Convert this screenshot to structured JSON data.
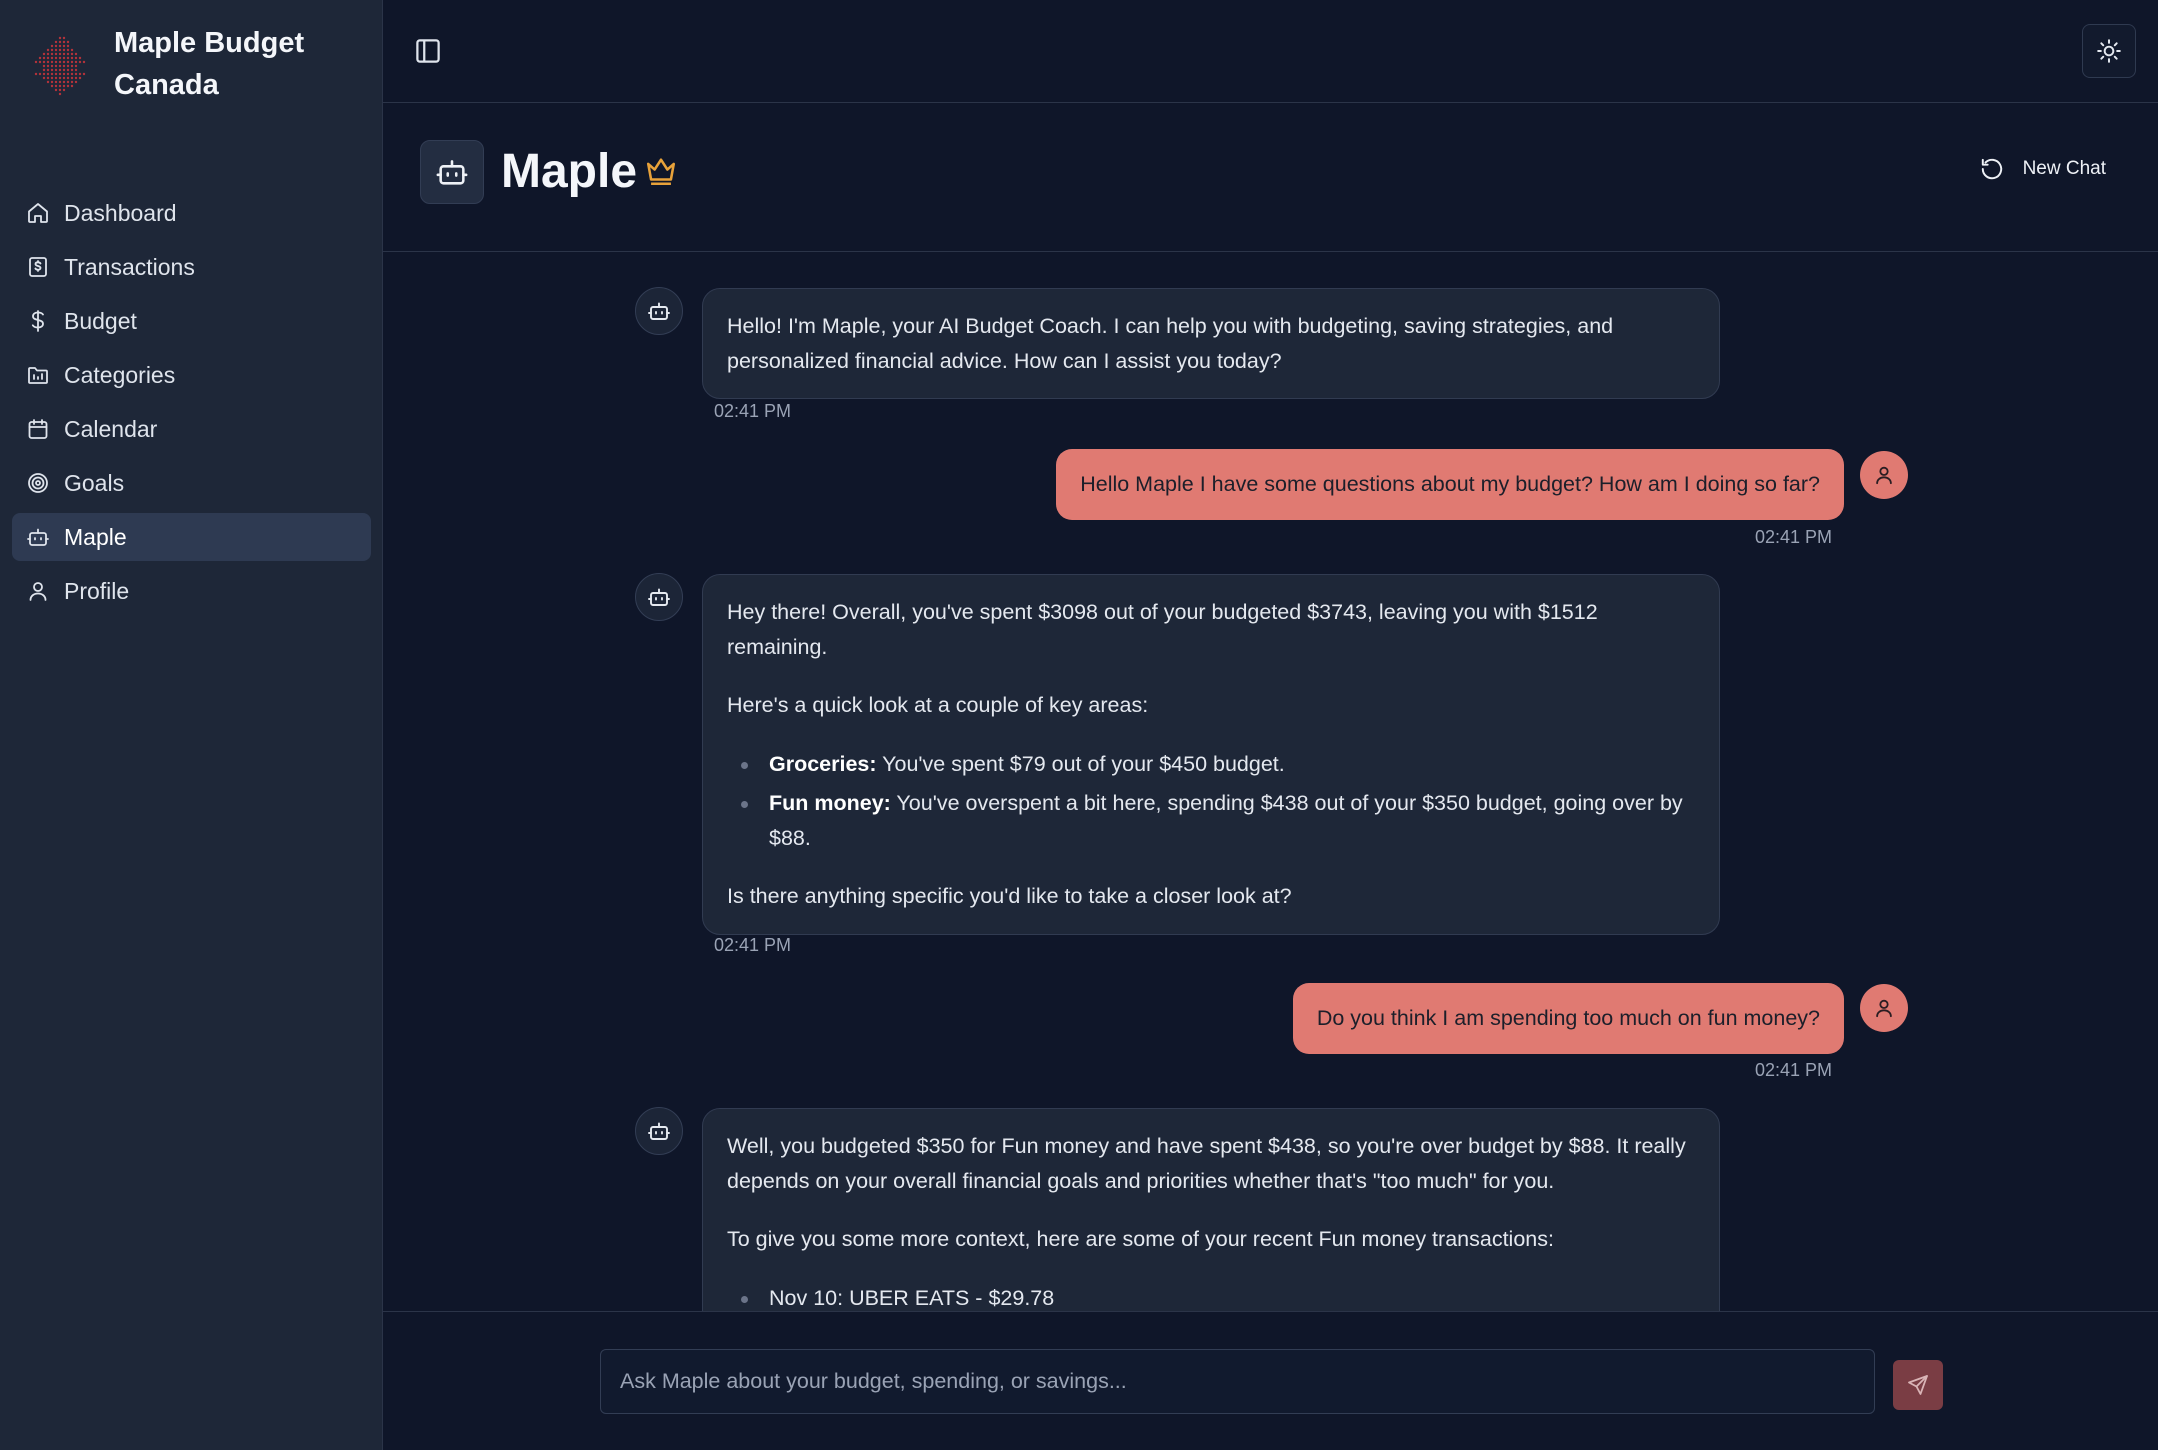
{
  "app": {
    "name": "Maple Budget Canada"
  },
  "sidebar": {
    "items": [
      {
        "label": "Dashboard",
        "icon": "home-icon",
        "active": false
      },
      {
        "label": "Transactions",
        "icon": "receipt-icon",
        "active": false
      },
      {
        "label": "Budget",
        "icon": "dollar-icon",
        "active": false
      },
      {
        "label": "Categories",
        "icon": "folder-icon",
        "active": false
      },
      {
        "label": "Calendar",
        "icon": "calendar-icon",
        "active": false
      },
      {
        "label": "Goals",
        "icon": "target-icon",
        "active": false
      },
      {
        "label": "Maple",
        "icon": "bot-icon",
        "active": true
      },
      {
        "label": "Profile",
        "icon": "user-icon",
        "active": false
      }
    ]
  },
  "topbar": {
    "sidebar_toggle_icon": "panel-left-icon",
    "theme_toggle_icon": "sun-icon"
  },
  "chat": {
    "title": "Maple",
    "title_badge_icon": "crown-icon",
    "new_chat_label": "New Chat",
    "new_chat_icon": "refresh-icon",
    "messages": [
      {
        "role": "assistant",
        "paragraphs": [
          "Hello! I'm Maple, your AI Budget Coach. I can help you with budgeting, saving strategies, and personalized financial advice. How can I assist you today?"
        ],
        "time": "02:41 PM"
      },
      {
        "role": "user",
        "text": "Hello Maple I have some questions about my budget? How am I doing so far?",
        "time": "02:41 PM"
      },
      {
        "role": "assistant",
        "intro": "Hey there! Overall, you've spent $3098 out of your budgeted $3743, leaving you with $1512 remaining.",
        "lead": "Here's a quick look at a couple of key areas:",
        "bullets": [
          {
            "term": "Groceries:",
            "text": " You've spent $79 out of your $450 budget."
          },
          {
            "term": "Fun money:",
            "text": " You've overspent a bit here, spending $438 out of your $350 budget, going over by $88."
          }
        ],
        "outro": "Is there anything specific you'd like to take a closer look at?",
        "time": "02:41 PM"
      },
      {
        "role": "user",
        "text": "Do you think I am spending too much on fun money?",
        "time": "02:41 PM"
      },
      {
        "role": "assistant",
        "intro": "Well, you budgeted $350 for Fun money and have spent $438, so you're over budget by $88. It really depends on your overall financial goals and priorities whether that's \"too much\" for you.",
        "lead": "To give you some more context, here are some of your recent Fun money transactions:",
        "bullets": [
          {
            "text": "Nov 10: UBER EATS - $29.78"
          }
        ]
      }
    ]
  },
  "composer": {
    "placeholder": "Ask Maple about your budget, spending, or savings...",
    "send_icon": "send-icon"
  },
  "colors": {
    "background": "#0f1629",
    "sidebar": "#1e2738",
    "user_bubble": "#e07a72",
    "accent_crown": "#e8a23a",
    "send_button": "#7a3d44"
  }
}
